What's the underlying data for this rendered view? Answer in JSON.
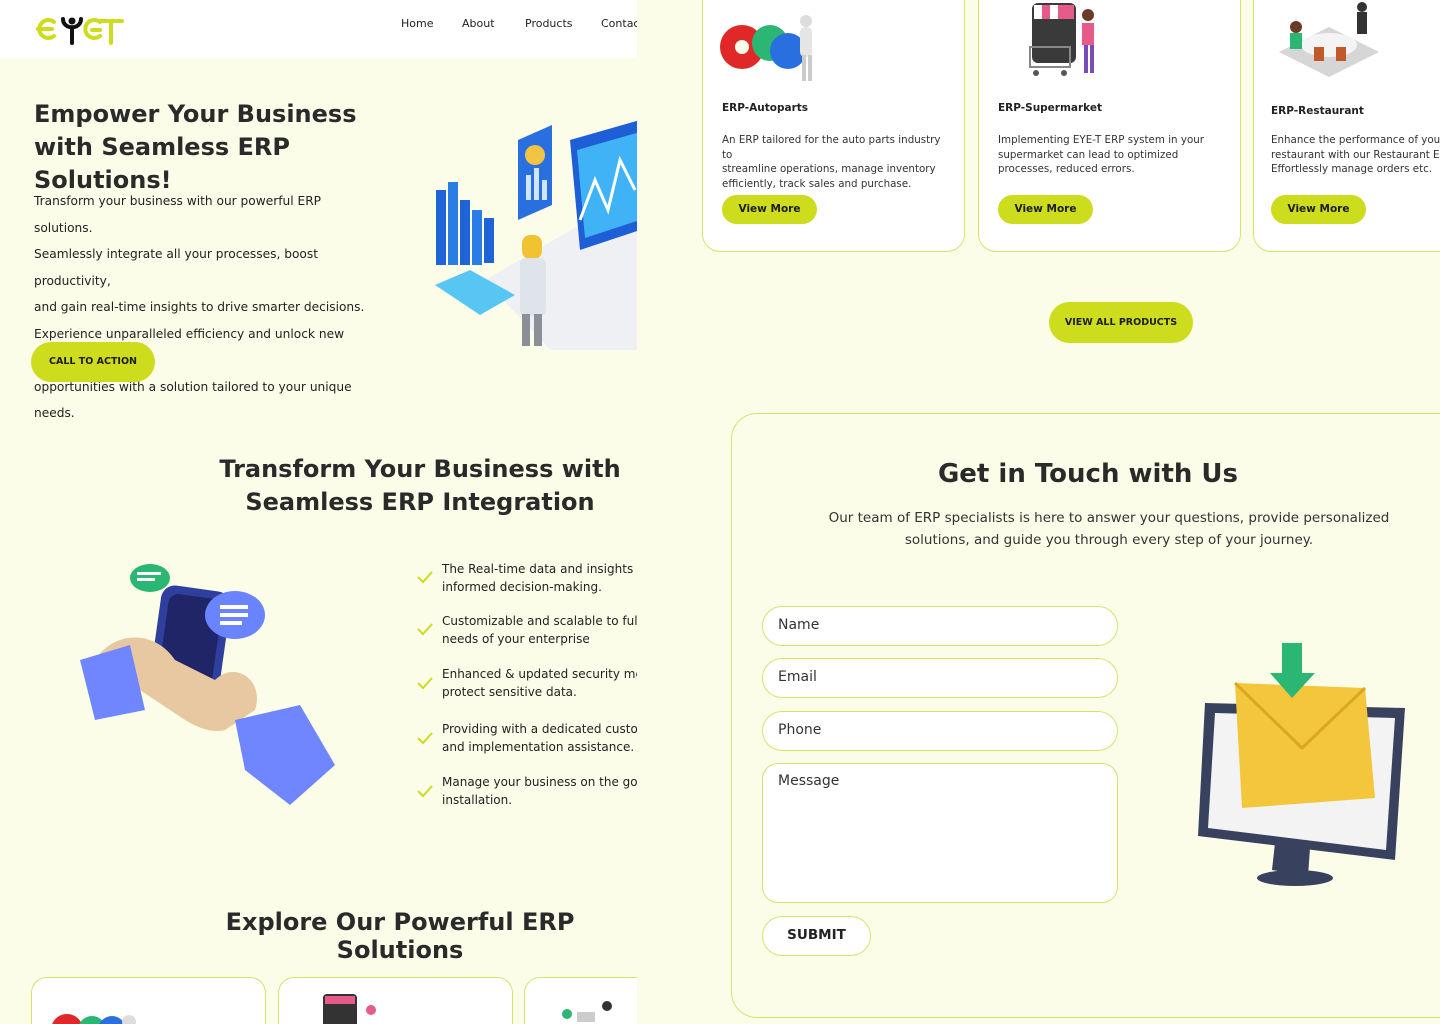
{
  "brand": {
    "logo_text": "EYET"
  },
  "nav": {
    "items": [
      "Home",
      "About",
      "Products",
      "Contact"
    ]
  },
  "hero": {
    "title": "Empower Your Business with Seamless ERP Solutions!",
    "lines": [
      "Transform your business with our powerful ERP solutions.",
      "Seamlessly integrate all your processes, boost productivity,",
      "and gain real-time insights to drive smarter decisions.",
      "Experience unparalleled efficiency and unlock new growth",
      "opportunities with a solution tailored to your unique needs."
    ],
    "cta": "CALL TO ACTION"
  },
  "integration": {
    "title_line1": "Transform Your Business with",
    "title_line2": "Seamless ERP Integration",
    "features": [
      [
        "The Real-time data and insights help",
        "informed decision-making."
      ],
      [
        "Customizable and scalable to fulfil the",
        "needs of your enterprise"
      ],
      [
        "Enhanced & updated security measures",
        "protect sensitive data."
      ],
      [
        "Providing with a dedicated customer",
        "and implementation assistance."
      ],
      [
        "Manage your business on the go with",
        "installation."
      ]
    ]
  },
  "solutions": {
    "title": "Explore Our Powerful ERP Solutions"
  },
  "products": {
    "cards": [
      {
        "title": "ERP-Autoparts",
        "text": [
          "An ERP tailored for the auto parts industry to",
          "streamline operations, manage inventory",
          "efficiently, track sales and purchase."
        ],
        "button": "View More"
      },
      {
        "title": "ERP-Supermarket",
        "text": [
          "Implementing EYE-T ERP system in your",
          "supermarket can lead to optimized",
          "processes, reduced errors."
        ],
        "button": "View More"
      },
      {
        "title": "ERP-Restaurant",
        "text": [
          "Enhance the performance of your",
          "restaurant with our Restaurant ERP.",
          "Effortlessly manage orders etc."
        ],
        "button": "View More"
      }
    ],
    "view_all": "VIEW ALL PRODUCTS"
  },
  "contact": {
    "title": "Get in Touch with Us",
    "desc_line1": "Our team of ERP specialists is here to answer your questions, provide personalized",
    "desc_line2": "solutions, and guide you through every step of your journey.",
    "name_ph": "Name",
    "email_ph": "Email",
    "phone_ph": "Phone",
    "message_ph": "Message",
    "submit": "SUBMIT"
  },
  "colors": {
    "accent": "#cddc1d",
    "background": "#fbfde9",
    "border": "#d8e36a",
    "text": "#2a2a2a"
  }
}
